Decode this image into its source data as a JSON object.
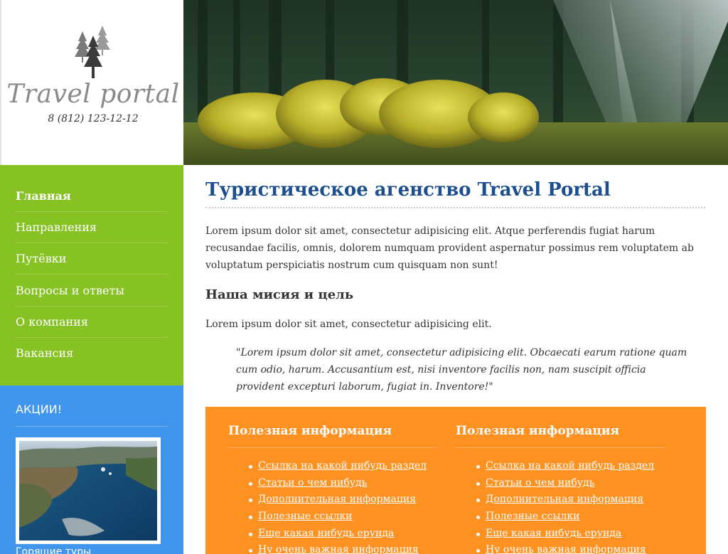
{
  "logo": {
    "title": "Travel portal",
    "phone": "8 (812) 123-12-12",
    "icon": "pine-trees-icon"
  },
  "nav": {
    "items": [
      {
        "label": "Главная",
        "active": true
      },
      {
        "label": "Направления"
      },
      {
        "label": "Путёвки"
      },
      {
        "label": "Вопросы и ответы"
      },
      {
        "label": "О компания"
      },
      {
        "label": "Вакансия"
      }
    ]
  },
  "promo": {
    "title": "АКЦИИ!",
    "caption": "Горящие туры"
  },
  "content": {
    "title": "Туристическое агенство Travel Portal",
    "intro": "Lorem ipsum dolor sit amet, consectetur adipisicing elit. Atque perferendis fugiat harum recusandae facilis, omnis, dolorem numquam provident aspernatur possimus rem voluptatem ab voluptatum perspiciatis nostrum cum quisquam non sunt!",
    "mission_heading": "Наша мисия и цель",
    "mission_text": "Lorem ipsum dolor sit amet, consectetur adipisicing elit.",
    "quote": "\"Lorem ipsum dolor sit amet, consectetur adipisicing elit. Obcaecati earum ratione quam cum odio, harum. Accusantium est, nisi inventore facilis non, nam suscipit officia provident excepturi laborum, fugiat in. Inventore!\""
  },
  "info": {
    "columns": [
      {
        "title": "Полезная информация",
        "links": [
          "Ссылка на какой нибудь раздел",
          "Статьи о чем нибудь",
          "Дополнительная информация",
          "Полезные ссылки",
          "Еще какая нибудь ерунда",
          "Ну очень важная информация"
        ]
      },
      {
        "title": "Полезная информация",
        "links": [
          "Ссылка на какой нибудь раздел",
          "Статьи о чем нибудь",
          "Дополнительная информация",
          "Полезные ссылки",
          "Еще какая нибудь ерунда",
          "Ну очень важная информация"
        ]
      }
    ]
  },
  "colors": {
    "nav_green": "#87c225",
    "promo_blue": "#4095ec",
    "info_orange": "#fd9223",
    "title_blue": "#1d4f8f"
  }
}
